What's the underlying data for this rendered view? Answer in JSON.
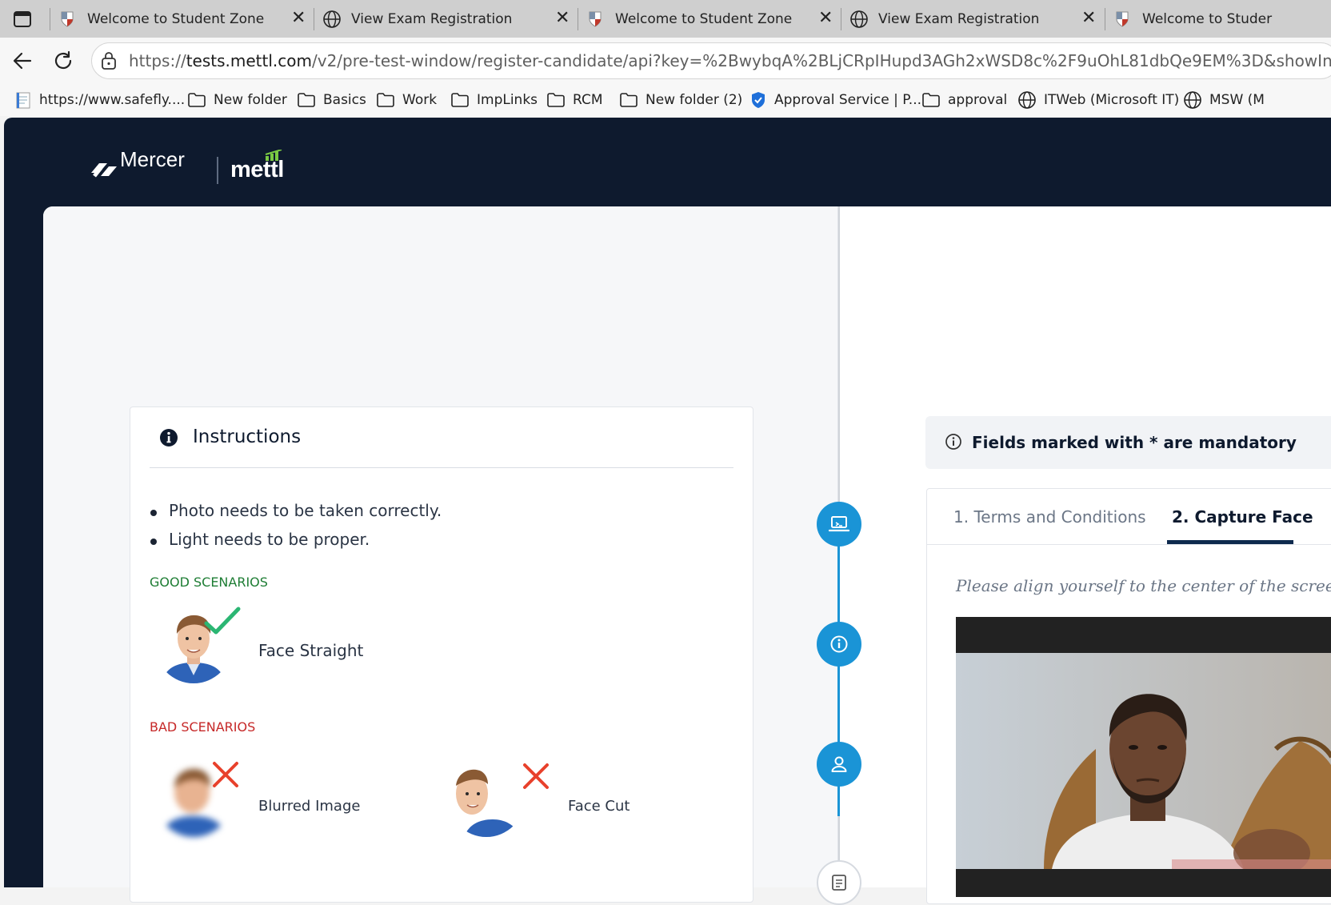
{
  "browser": {
    "tabs": [
      {
        "title": "Welcome to Student Zone",
        "icon": "shield-logo-icon"
      },
      {
        "title": "View Exam Registration",
        "icon": "globe-icon"
      },
      {
        "title": "Welcome to Student Zone",
        "icon": "shield-logo-icon"
      },
      {
        "title": "View Exam Registration",
        "icon": "globe-icon"
      },
      {
        "title": "Welcome to Studer",
        "icon": "shield-logo-icon"
      }
    ],
    "close_glyph": "✕",
    "url_prefix": "https://",
    "url_host": "tests.mettl.com",
    "url_path": "/v2/pre-test-window/register-candidate/api?key=%2BwybqA%2BLjCRpIHupd3AGh2xWSD8c%2F9uOhL81dbQe9EM%3D&showInst=true",
    "bookmarks": [
      {
        "label": "https://www.safefly....",
        "icon": "page-icon"
      },
      {
        "label": "New folder",
        "icon": "folder-icon"
      },
      {
        "label": "Basics",
        "icon": "folder-icon"
      },
      {
        "label": "Work",
        "icon": "folder-icon"
      },
      {
        "label": "ImpLinks",
        "icon": "folder-icon"
      },
      {
        "label": "RCM",
        "icon": "folder-icon"
      },
      {
        "label": "New folder (2)",
        "icon": "folder-icon"
      },
      {
        "label": "Approval Service | P...",
        "icon": "shield-check-icon"
      },
      {
        "label": "approval",
        "icon": "folder-icon"
      },
      {
        "label": "ITWeb (Microsoft IT)",
        "icon": "globe-icon"
      },
      {
        "label": "MSW (M",
        "icon": "globe-icon"
      }
    ]
  },
  "brand": {
    "mercer": "Mercer",
    "mettl": "mettl"
  },
  "instructions": {
    "title": "Instructions",
    "bullets": [
      "Photo needs to be taken correctly.",
      "Light needs to be proper."
    ],
    "good_label": "GOOD SCENARIOS",
    "good": [
      {
        "label": "Face Straight"
      }
    ],
    "bad_label": "BAD SCENARIOS",
    "bad": [
      {
        "label": "Blurred Image"
      },
      {
        "label": "Face Cut"
      }
    ]
  },
  "stepper": {
    "steps": [
      {
        "icon": "laptop-icon",
        "state": "active"
      },
      {
        "icon": "info-icon",
        "state": "active"
      },
      {
        "icon": "user-icon",
        "state": "active"
      },
      {
        "icon": "form-icon",
        "state": "inactive"
      }
    ]
  },
  "right": {
    "mandatory_note": "Fields marked with * are mandatory",
    "tabs": [
      {
        "label": "1. Terms and Conditions",
        "active": false
      },
      {
        "label": "2. Capture Face",
        "active": true
      }
    ],
    "hint": "Please align yourself to the center of the screen and"
  },
  "colors": {
    "navy": "#0e1a2e",
    "accent": "#1a94d6",
    "good": "#1e7d34",
    "bad": "#c62828"
  }
}
